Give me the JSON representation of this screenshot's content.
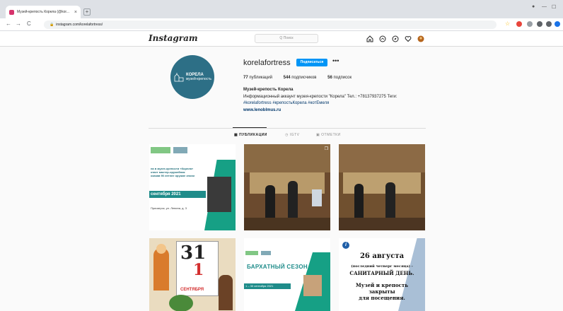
{
  "browser": {
    "tab_title": "Музей-крепость Корела (@kor...",
    "tab_close": "×",
    "new_tab": "+",
    "url": "instagram.com/korelafortress/",
    "back": "←",
    "forward": "→",
    "reload": "C"
  },
  "instagram": {
    "logo": "Instagram",
    "search_placeholder": "Q Поиск"
  },
  "profile": {
    "username": "korelafortress",
    "follow_label": "Подписаться",
    "more": "•••",
    "avatar_name": "КОРЕЛА",
    "avatar_sub": "музей-крепость",
    "posts_count": "77",
    "posts_label": "публикаций",
    "followers_count": "544",
    "followers_label": "подписчиков",
    "following_count": "56",
    "following_label": "подписок",
    "bio_name": "Музей-крепость Корела",
    "bio_text": "Информационный аккаунт музея-крепости \"Корела\" Тел.: +78137937275 Теги:",
    "bio_tags": "#korelafortress #крепостьКорела #котЕмеля",
    "bio_link": "www.lenoblmus.ru"
  },
  "tabs": {
    "posts": "ПУБЛИКАЦИИ",
    "igtv": "IGTV",
    "tagged": "ОТМЕТКИ"
  },
  "posts": {
    "p1_line1": "на в музее-крепости «Корела»",
    "p1_line2": "отает мастер-оружейник",
    "p1_line3": "оказав 90 летнее оружие эпохи",
    "p1_date": "сентября 2021",
    "p1_addr": "Приозерск, ул. Ленина, д. 3",
    "p4_num": "31",
    "p4_month": "СЕНТЯБРЯ",
    "p5_title": "БАРХАТНЫЙ СЕЗОН",
    "p5_dates": "1 – 30 сентября 2021",
    "p6_line1": "26 августа",
    "p6_line2": "(последний четверг месяца) -",
    "p6_line3": "САНИТАРНЫЙ ДЕНЬ.",
    "p6_line4": "Музей и крепость",
    "p6_line5": "закрыты",
    "p6_line6": "для посещения."
  }
}
